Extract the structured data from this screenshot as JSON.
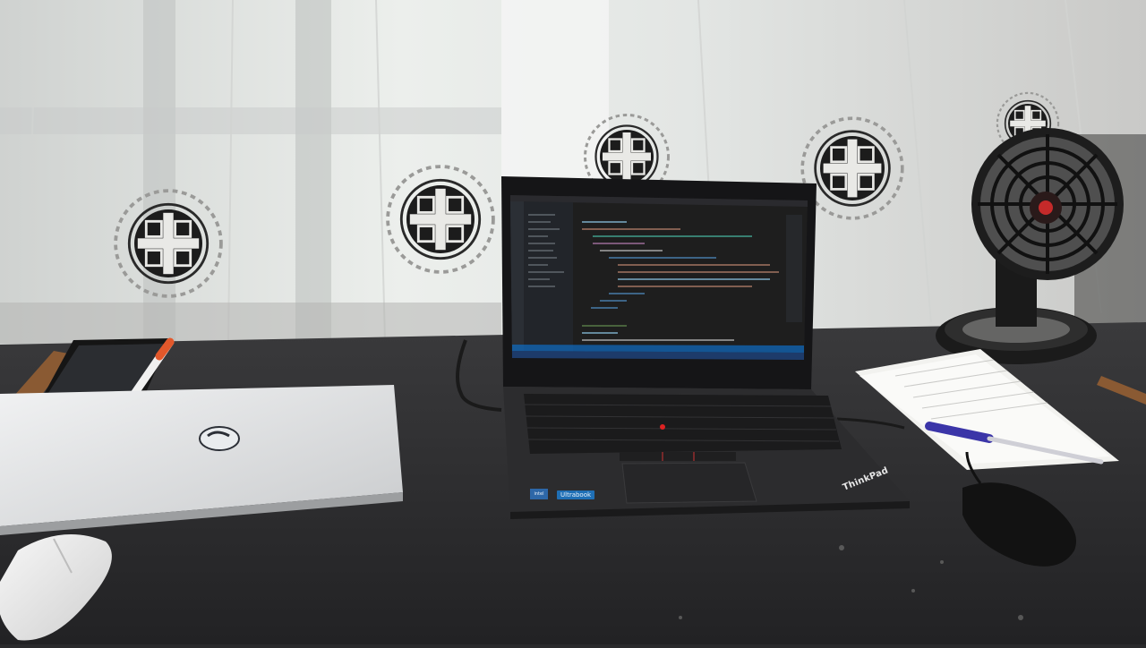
{
  "scene": {
    "description_objects": [
      "curtain-with-circular-motifs",
      "desk-fan",
      "silver-laptop-closed",
      "thinkpad-laptop-open",
      "smartphone",
      "marker-pen",
      "wireless-mouse-white",
      "wired-mouse-black",
      "paper-notebook",
      "blue-pen"
    ],
    "laptop_screen": {
      "app": "code-editor",
      "theme": "dark"
    },
    "branding": {
      "thinkpad": "ThinkPad",
      "ultrabook": "Ultrabook",
      "intel": "intel"
    },
    "colors": {
      "curtain": "#e9e9e6",
      "desk": "#2b2b2d",
      "screen_bg": "#1e1e1e",
      "taskbar": "#1d3b6a",
      "fan_body": "#1a1a1a"
    }
  }
}
